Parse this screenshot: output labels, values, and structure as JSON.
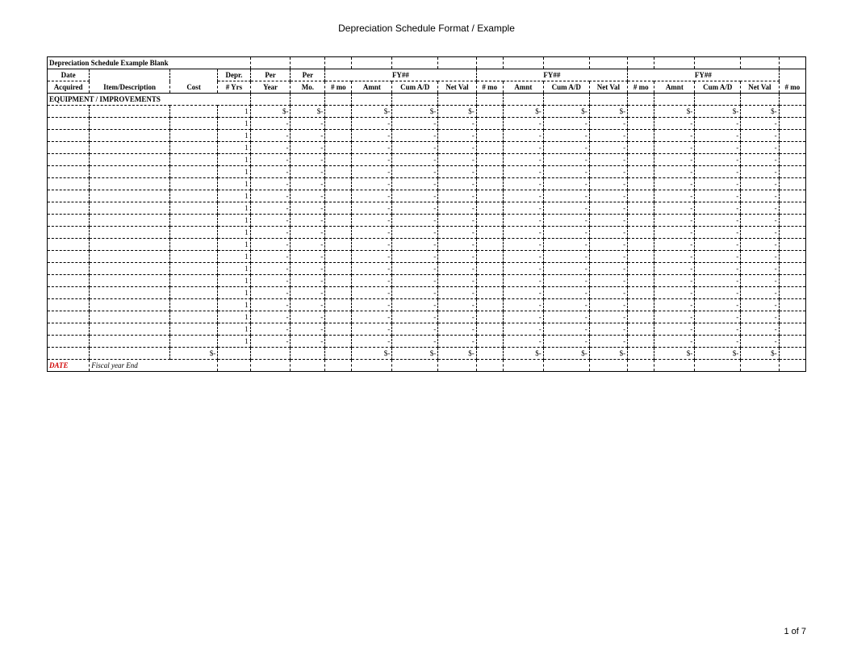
{
  "doc_title": "Depreciation Schedule Format / Example",
  "sheet_title": "Depreciation Schedule Example Blank",
  "group1": {
    "date_lbl": "Date",
    "depr_lbl": "Depr.",
    "per1_lbl": "Per",
    "per2_lbl": "Per",
    "fy_lbl": "FY##"
  },
  "headers": {
    "acquired": "Acquired",
    "item": "Item/Description",
    "cost": "Cost",
    "yrs": "# Yrs",
    "year": "Year",
    "mo": "Mo.",
    "nmo": "# mo",
    "amnt": "Amnt",
    "cum": "Cum A/D",
    "netval": "Net Val"
  },
  "section_label": "EQUIPMENT / IMPROVEMENTS",
  "row_count": 20,
  "cell_yrs": "1",
  "cell_dollar": "$-",
  "cell_dash": "-",
  "totals_dollar": "$-",
  "footer_red": "DATE",
  "footer_text": "Fiscal year End",
  "page_number": "1 of 7"
}
